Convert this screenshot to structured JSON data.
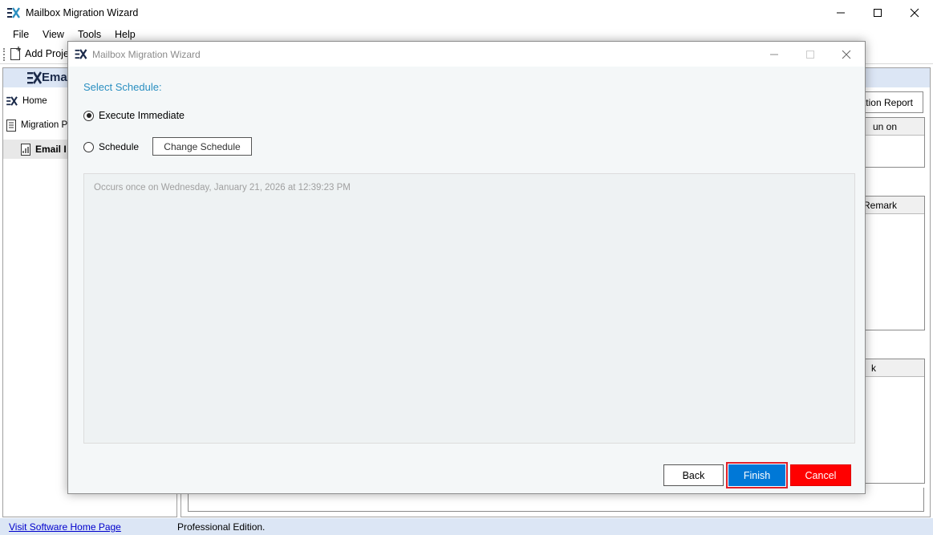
{
  "main_window": {
    "title": "Mailbox Migration Wizard",
    "menu": [
      "File",
      "View",
      "Tools",
      "Help"
    ],
    "toolbar": {
      "add_project_label": "Add Proje"
    },
    "left_panel": {
      "brand": "Ema",
      "nav": [
        {
          "label": "Home"
        },
        {
          "label": "Migration Pr"
        },
        {
          "label": "Email I"
        }
      ]
    },
    "right_panel": {
      "report_button": "ration Report",
      "grid1_header": "un on",
      "grid2_header": "Remark",
      "grid3_header": "k"
    },
    "status": {
      "link": "Visit Software Home Page",
      "edition": "Professional Edition."
    }
  },
  "dialog": {
    "title": "Mailbox Migration Wizard",
    "section_title": "Select Schedule:",
    "options": {
      "immediate": "Execute Immediate",
      "schedule": "Schedule"
    },
    "selected_option": "immediate",
    "change_schedule_label": "Change Schedule",
    "description": "Occurs once on Wednesday, January 21, 2026 at 12:39:23 PM",
    "buttons": {
      "back": "Back",
      "finish": "Finish",
      "cancel": "Cancel"
    }
  },
  "colors": {
    "accent_blue": "#0078d7",
    "section_title": "#2a8fc1",
    "cancel_red": "#ff0000",
    "highlight_border": "#e0202a",
    "panel_header": "#dce6f5"
  }
}
